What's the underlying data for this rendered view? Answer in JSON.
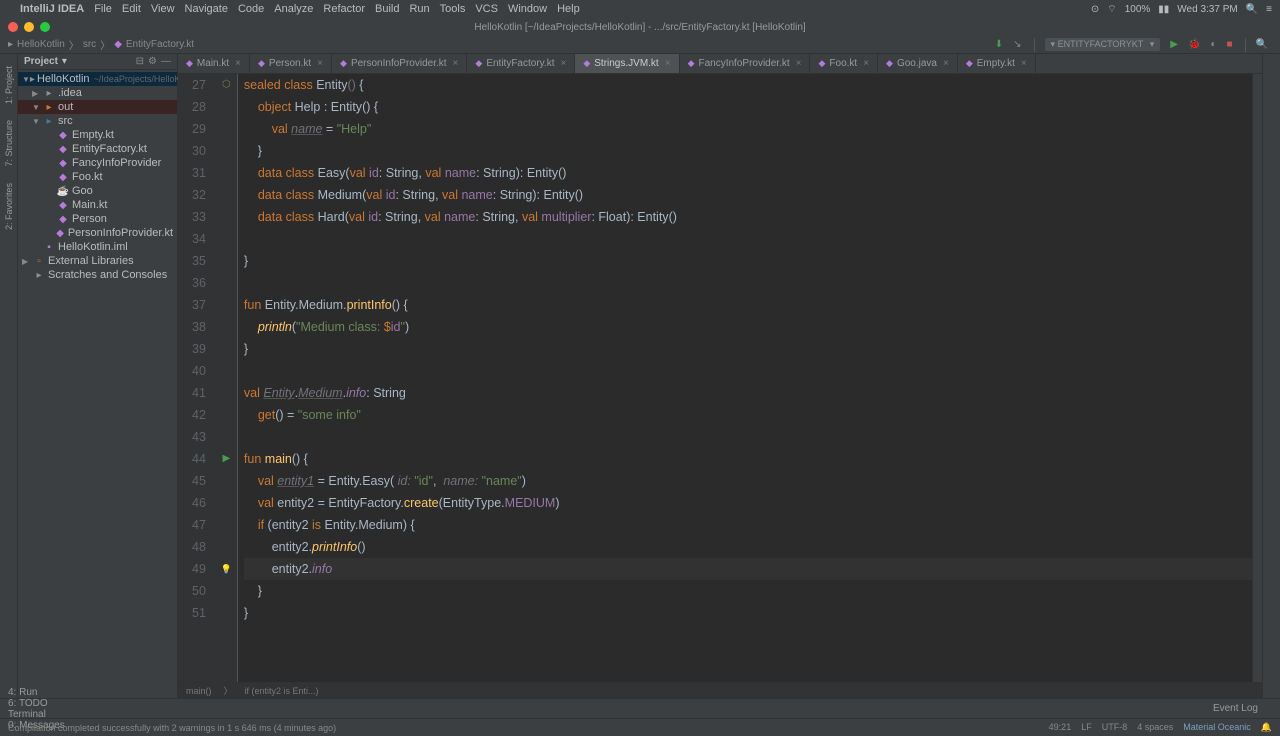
{
  "menubar": {
    "app": "IntelliJ IDEA",
    "items": [
      "File",
      "Edit",
      "View",
      "Navigate",
      "Code",
      "Analyze",
      "Refactor",
      "Build",
      "Run",
      "Tools",
      "VCS",
      "Window",
      "Help"
    ],
    "battery": "100%",
    "clock": "Wed 3:37 PM"
  },
  "titlebar": "HelloKotlin [~/IdeaProjects/HelloKotlin] - .../src/EntityFactory.kt [HelloKotlin]",
  "breadcrumb": {
    "project": "HelloKotlin",
    "folder": "src",
    "file": "EntityFactory.kt",
    "config": "ENTITYFACTORYKT"
  },
  "sidebar": {
    "title": "Project",
    "rows": [
      {
        "depth": 0,
        "arrow": "▼",
        "icon": "folder",
        "label": "HelloKotlin",
        "hint": "~/IdeaProjects/HelloKotlin",
        "sel": true,
        "cls": "folder"
      },
      {
        "depth": 1,
        "arrow": "▶",
        "icon": "folder",
        "label": ".idea",
        "cls": "folder"
      },
      {
        "depth": 1,
        "arrow": "▼",
        "icon": "folder",
        "label": "out",
        "cls": "out",
        "sel2": true
      },
      {
        "depth": 1,
        "arrow": "▼",
        "icon": "folder",
        "label": "src",
        "cls": "src"
      },
      {
        "depth": 2,
        "icon": "kt",
        "label": "Empty.kt",
        "cls": "kt"
      },
      {
        "depth": 2,
        "icon": "kt",
        "label": "EntityFactory.kt",
        "cls": "kt"
      },
      {
        "depth": 2,
        "icon": "kt",
        "label": "FancyInfoProvider",
        "cls": "kt"
      },
      {
        "depth": 2,
        "icon": "kt",
        "label": "Foo.kt",
        "cls": "kt"
      },
      {
        "depth": 2,
        "icon": "java",
        "label": "Goo",
        "cls": "java"
      },
      {
        "depth": 2,
        "icon": "kt",
        "label": "Main.kt",
        "cls": "kt"
      },
      {
        "depth": 2,
        "icon": "kt",
        "label": "Person",
        "cls": "kt"
      },
      {
        "depth": 2,
        "icon": "kt",
        "label": "PersonInfoProvider.kt",
        "cls": "kt"
      },
      {
        "depth": 1,
        "icon": "iml",
        "label": "HelloKotlin.iml",
        "cls": "iml"
      },
      {
        "depth": 0,
        "arrow": "▶",
        "icon": "lib",
        "label": "External Libraries",
        "cls": "lib"
      },
      {
        "depth": 0,
        "icon": "folder",
        "label": "Scratches and Consoles",
        "cls": "folder"
      }
    ]
  },
  "tabs": [
    {
      "label": "Main.kt"
    },
    {
      "label": "Person.kt"
    },
    {
      "label": "PersonInfoProvider.kt"
    },
    {
      "label": "EntityFactory.kt"
    },
    {
      "label": "Strings.JVM.kt",
      "active": true
    },
    {
      "label": "FancyInfoProvider.kt"
    },
    {
      "label": "Foo.kt"
    },
    {
      "label": "Goo.java"
    },
    {
      "label": "Empty.kt"
    }
  ],
  "code": {
    "start": 27,
    "ovr": [
      27
    ],
    "run": [
      44
    ],
    "bulb": [
      49
    ],
    "hl": [
      49
    ],
    "lines": [
      "<span class='kw'>sealed</span> <span class='kw'>class</span> <span class='typ'>Entity</span><span class='grey'>()</span> {",
      "    <span class='kw'>object</span> <span class='typ'>Help</span> : <span class='typ'>Entity</span>() {",
      "        <span class='kw'>val</span> <span class='greyi'>name</span> = <span class='str'>\"Help\"</span>",
      "    }",
      "    <span class='kw'>data</span> <span class='kw'>class</span> <span class='typ'>Easy</span>(<span class='kw'>val</span> <span class='pur'>id</span>: <span class='typ'>String</span>, <span class='kw'>val</span> <span class='pur'>name</span>: <span class='typ'>String</span>): <span class='typ'>Entity</span>()",
      "    <span class='kw'>data</span> <span class='kw'>class</span> <span class='typ'>Medium</span>(<span class='kw'>val</span> <span class='pur'>id</span>: <span class='typ'>String</span>, <span class='kw'>val</span> <span class='pur'>name</span>: <span class='typ'>String</span>): <span class='typ'>Entity</span>()",
      "    <span class='kw'>data</span> <span class='kw'>class</span> <span class='typ'>Hard</span>(<span class='kw'>val</span> <span class='pur'>id</span>: <span class='typ'>String</span>, <span class='kw'>val</span> <span class='pur'>name</span>: <span class='typ'>String</span>, <span class='kw'>val</span> <span class='pur'>multiplier</span>: <span class='typ'>Float</span>): <span class='typ'>Entity</span>()",
      "",
      "}",
      "",
      "<span class='kw'>fun</span> <span class='typ'>Entity</span>.<span class='typ'>Medium</span>.<span class='fn'>printInfo</span>() {",
      "    <span class='fni'>println</span>(<span class='str'>\"Medium class: </span><span class='kw'>$</span><span class='pur'>id</span><span class='str'>\"</span>)",
      "}",
      "",
      "<span class='kw'>val</span> <span class='greyi'>Entity</span>.<span class='greyi'>Medium</span>.<span class='puri'>info</span>: <span class='typ'>String</span>",
      "    <span class='kw'>get</span>() = <span class='str'>\"some info\"</span>",
      "",
      "<span class='kw'>fun</span> <span class='fn'>main</span>() {",
      "    <span class='kw'>val</span> <span class='greyi'>entity1</span> = <span class='typ'>Entity</span>.<span class='typ'>Easy</span>( <span class='param'>id:</span> <span class='str'>\"id\"</span>,  <span class='param'>name:</span> <span class='str'>\"name\"</span>)",
      "    <span class='kw'>val</span> <span class='id'>entity2</span> = <span class='typ'>EntityFactory</span>.<span class='fn'>create</span>(<span class='typ'>EntityType</span>.<span class='pur'>MEDIUM</span>)",
      "    <span class='kw'>if</span> (<span class='id'>entity2</span> <span class='kw'>is</span> <span class='typ'>Entity</span>.<span class='typ'>Medium</span>) {",
      "        <span class='id'>entity2</span>.<span class='fni'>printInfo</span>()",
      "        <span class='id'>entity2</span>.<span class='puri'>info</span>",
      "    }",
      "}"
    ]
  },
  "code_footer": [
    "main()",
    "if (entity2 is Enti...)"
  ],
  "bottom_tools": [
    "4: Run",
    "6: TODO",
    "Terminal",
    "0: Messages"
  ],
  "bottom_right": "Event Log",
  "status": {
    "msg": "Compilation completed successfully with 2 warnings in 1 s 646 ms (4 minutes ago)",
    "pos": "49:21",
    "lf": "LF",
    "enc": "UTF-8",
    "spaces": "4 spaces",
    "mat": "Material Oceanic"
  }
}
